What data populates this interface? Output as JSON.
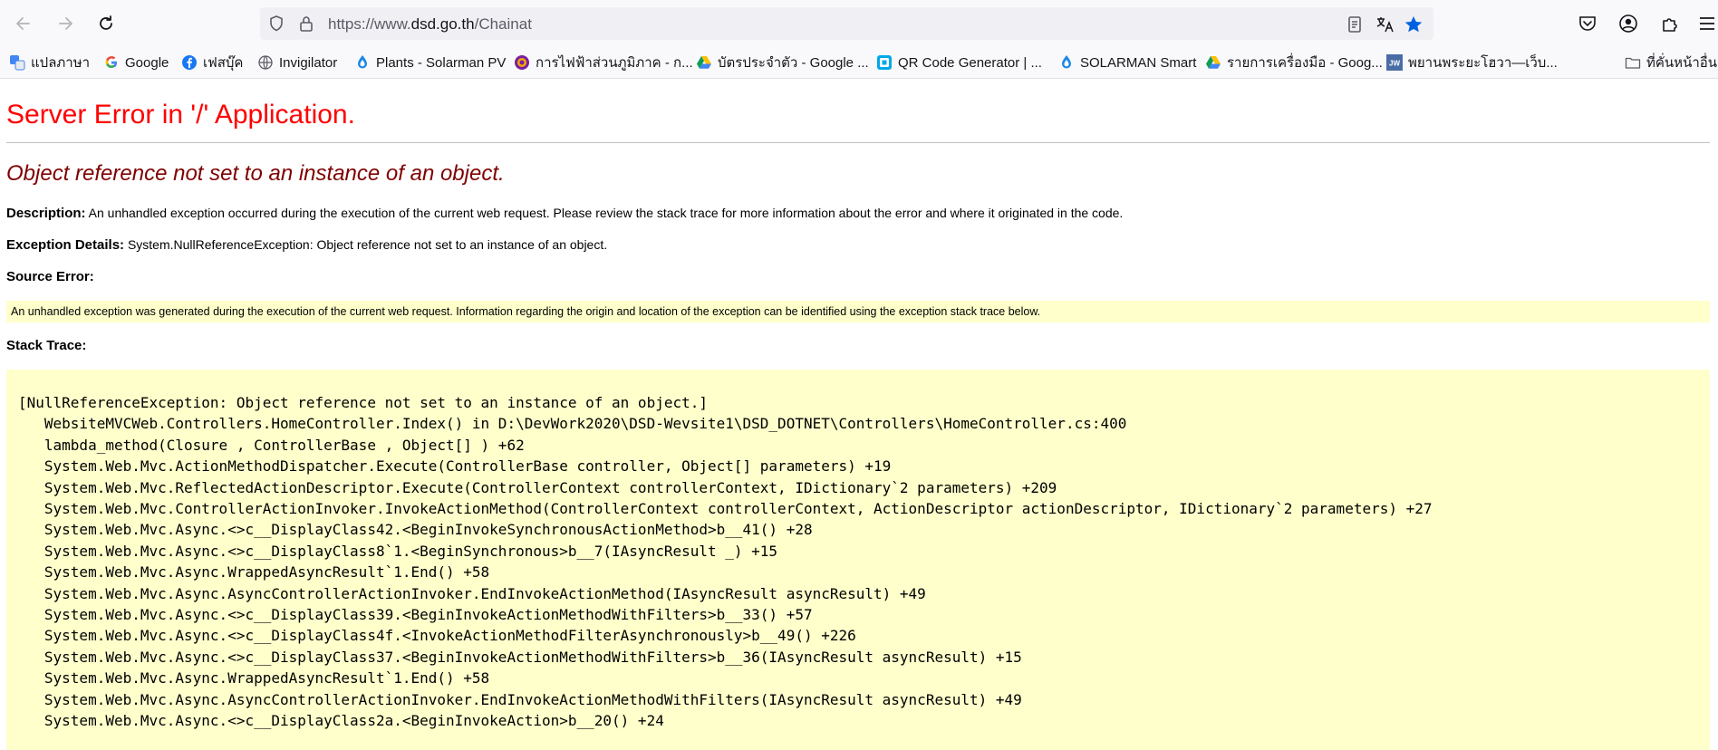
{
  "browser": {
    "url_scheme": "https://www.",
    "url_host": "dsd.go.th",
    "url_path": "/Chainat",
    "bookmarks": [
      {
        "label": "แปลภาษา",
        "icon": "translate-icon",
        "color": "#4285f4"
      },
      {
        "label": "Google",
        "icon": "google-icon",
        "color": "#4285f4"
      },
      {
        "label": "เฟสบุ๊ค",
        "icon": "facebook-icon",
        "color": "#1877f2"
      },
      {
        "label": "Invigilator",
        "icon": "globe-icon",
        "color": "#5b5b66"
      },
      {
        "label": "Plants - Solarman PV",
        "icon": "solarman-icon",
        "color": "#1e88e5"
      },
      {
        "label": "การไฟฟ้าส่วนภูมิภาค - ก...",
        "icon": "pea-icon",
        "color": "#7b1fa2"
      },
      {
        "label": "บัตรประจำตัว - Google ...",
        "icon": "google-drive-icon",
        "color": "#0f9d58"
      },
      {
        "label": "QR Code Generator | ...",
        "icon": "qr-code-icon",
        "color": "#00a8e8"
      },
      {
        "label": "SOLARMAN Smart",
        "icon": "solarman-icon",
        "color": "#1e88e5"
      },
      {
        "label": "รายการเครื่องมือ - Goog...",
        "icon": "google-drive-icon",
        "color": "#0f9d58"
      },
      {
        "label": "พยานพระยะโฮวา—เว็บ...",
        "icon": "jw-icon",
        "color": "#4a6da7"
      },
      {
        "label": "ที่คั่นหน้าอื่น",
        "icon": "folder-icon",
        "color": "#5b5b66"
      }
    ]
  },
  "error": {
    "title": "Server Error in '/' Application.",
    "subtitle": "Object reference not set to an instance of an object.",
    "description_label": "Description:",
    "description_text": "An unhandled exception occurred during the execution of the current web request. Please review the stack trace for more information about the error and where it originated in the code.",
    "exception_label": "Exception Details:",
    "exception_text": "System.NullReferenceException: Object reference not set to an instance of an object.",
    "source_label": "Source Error:",
    "source_text": "An unhandled exception was generated during the execution of the current web request. Information regarding the origin and location of the exception can be identified using the exception stack trace below.",
    "stack_label": "Stack Trace:",
    "stack_lines": [
      "[NullReferenceException: Object reference not set to an instance of an object.]",
      "   WebsiteMVCWeb.Controllers.HomeController.Index() in D:\\DevWork2020\\DSD-Wevsite1\\DSD_DOTNET\\Controllers\\HomeController.cs:400",
      "   lambda_method(Closure , ControllerBase , Object[] ) +62",
      "   System.Web.Mvc.ActionMethodDispatcher.Execute(ControllerBase controller, Object[] parameters) +19",
      "   System.Web.Mvc.ReflectedActionDescriptor.Execute(ControllerContext controllerContext, IDictionary`2 parameters) +209",
      "   System.Web.Mvc.ControllerActionInvoker.InvokeActionMethod(ControllerContext controllerContext, ActionDescriptor actionDescriptor, IDictionary`2 parameters) +27",
      "   System.Web.Mvc.Async.<>c__DisplayClass42.<BeginInvokeSynchronousActionMethod>b__41() +28",
      "   System.Web.Mvc.Async.<>c__DisplayClass8`1.<BeginSynchronous>b__7(IAsyncResult _) +15",
      "   System.Web.Mvc.Async.WrappedAsyncResult`1.End() +58",
      "   System.Web.Mvc.Async.AsyncControllerActionInvoker.EndInvokeActionMethod(IAsyncResult asyncResult) +49",
      "   System.Web.Mvc.Async.<>c__DisplayClass39.<BeginInvokeActionMethodWithFilters>b__33() +57",
      "   System.Web.Mvc.Async.<>c__DisplayClass4f.<InvokeActionMethodFilterAsynchronously>b__49() +226",
      "   System.Web.Mvc.Async.<>c__DisplayClass37.<BeginInvokeActionMethodWithFilters>b__36(IAsyncResult asyncResult) +15",
      "   System.Web.Mvc.Async.WrappedAsyncResult`1.End() +58",
      "   System.Web.Mvc.Async.AsyncControllerActionInvoker.EndInvokeActionMethodWithFilters(IAsyncResult asyncResult) +49",
      "   System.Web.Mvc.Async.<>c__DisplayClass2a.<BeginInvokeAction>b__20() +24"
    ]
  }
}
